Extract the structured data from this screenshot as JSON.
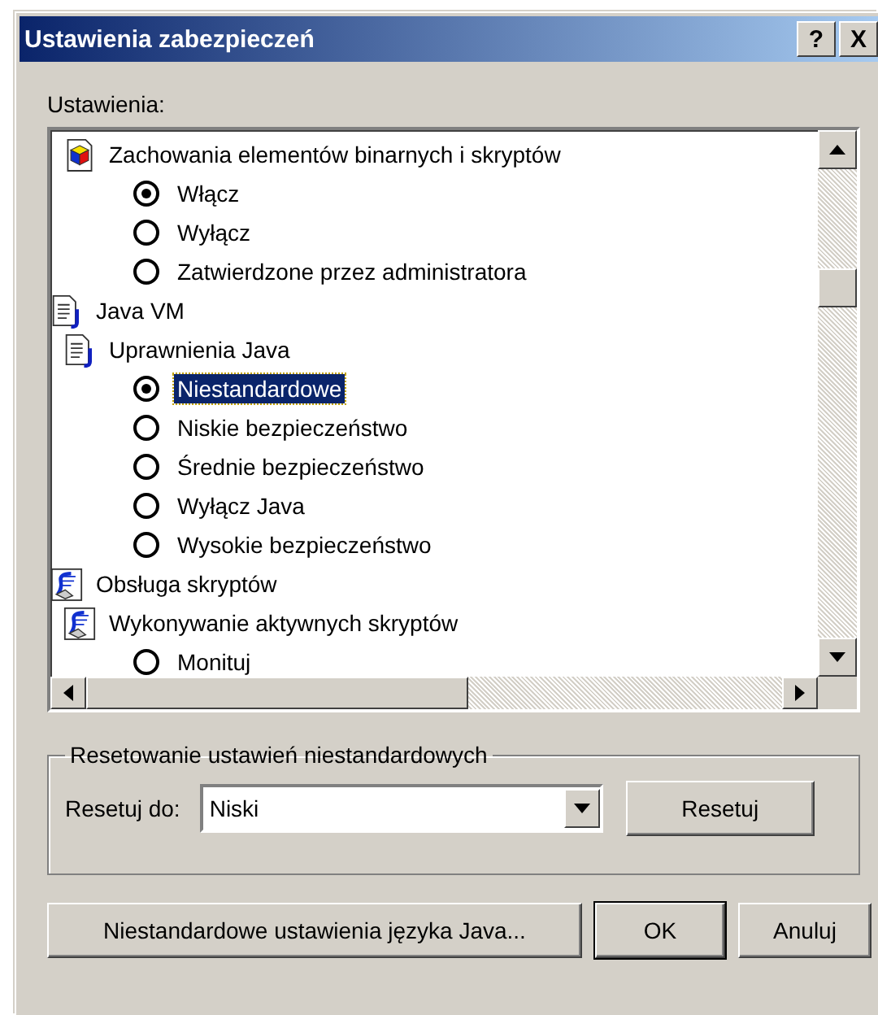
{
  "window": {
    "title": "Ustawienia zabezpieczeń",
    "title_buttons": [
      "?",
      "X"
    ]
  },
  "settings_label": "Ustawienia:",
  "tree": {
    "items": [
      {
        "children": [
          {
            "label": "Zachowania elementów binarnych i skryptów",
            "kind": "component",
            "children": [
              {
                "label": "Włącz",
                "kind": "option",
                "selected": true,
                "highlighted": false
              },
              {
                "label": "Wyłącz",
                "kind": "option",
                "selected": false,
                "highlighted": false
              },
              {
                "label": "Zatwierdzone przez administratora",
                "kind": "option",
                "selected": false,
                "highlighted": false
              }
            ]
          }
        ]
      },
      {
        "label": "Java VM",
        "kind": "java",
        "children": [
          {
            "label": "Uprawnienia Java",
            "kind": "java",
            "children": [
              {
                "label": "Niestandardowe",
                "kind": "option",
                "selected": true,
                "highlighted": true
              },
              {
                "label": "Niskie bezpieczeństwo",
                "kind": "option",
                "selected": false,
                "highlighted": false
              },
              {
                "label": "Średnie bezpieczeństwo",
                "kind": "option",
                "selected": false,
                "highlighted": false
              },
              {
                "label": "Wyłącz Java",
                "kind": "option",
                "selected": false,
                "highlighted": false
              },
              {
                "label": "Wysokie bezpieczeństwo",
                "kind": "option",
                "selected": false,
                "highlighted": false
              }
            ]
          }
        ]
      },
      {
        "label": "Obsługa skryptów",
        "kind": "script",
        "children": [
          {
            "label": "Wykonywanie aktywnych skryptów",
            "kind": "script",
            "children": [
              {
                "label": "Monituj",
                "kind": "option",
                "selected": false,
                "highlighted": false
              }
            ]
          }
        ]
      }
    ]
  },
  "reset_group": {
    "title": "Resetowanie ustawień niestandardowych",
    "label": "Resetuj do:",
    "value": "Niski",
    "button": "Resetuj"
  },
  "buttons": [
    "Niestandardowe ustawienia języka Java...",
    "OK",
    "Anuluj"
  ]
}
